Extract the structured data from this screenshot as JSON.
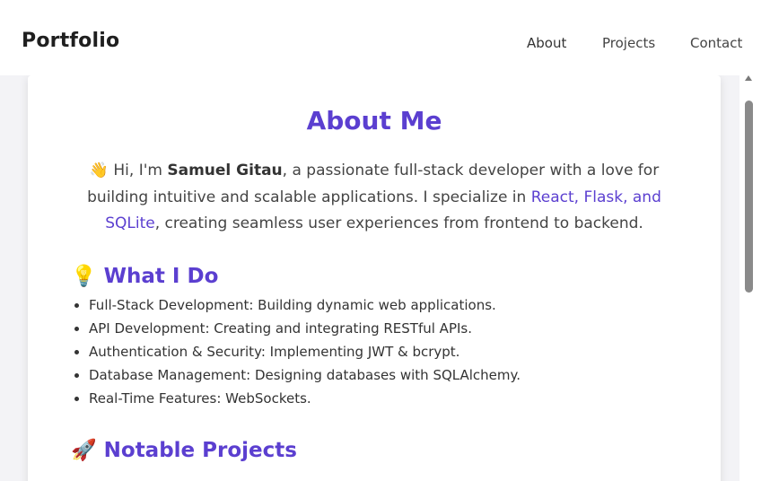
{
  "nav": {
    "brand": "Portfolio",
    "links": [
      "About",
      "Projects",
      "Contact"
    ]
  },
  "about": {
    "title": "About Me",
    "intro": {
      "wave_emoji": "👋",
      "part1": "Hi, I'm ",
      "name": "Samuel Gitau",
      "part2": ", a passionate full-stack developer with a love for building intuitive and scalable applications. I specialize in ",
      "tech": "React, Flask, and SQLite",
      "part3": ", creating seamless user experiences from frontend to backend."
    }
  },
  "what_i_do": {
    "emoji": "💡",
    "heading": "What I Do",
    "items": [
      "Full-Stack Development: Building dynamic web applications.",
      "API Development: Creating and integrating RESTful APIs.",
      "Authentication & Security: Implementing JWT & bcrypt.",
      "Database Management: Designing databases with SQLAlchemy.",
      "Real-Time Features: WebSockets."
    ]
  },
  "notable_projects": {
    "emoji": "🚀",
    "heading": "Notable Projects"
  },
  "colors": {
    "accent": "#5b3fd0",
    "text": "#333333"
  }
}
